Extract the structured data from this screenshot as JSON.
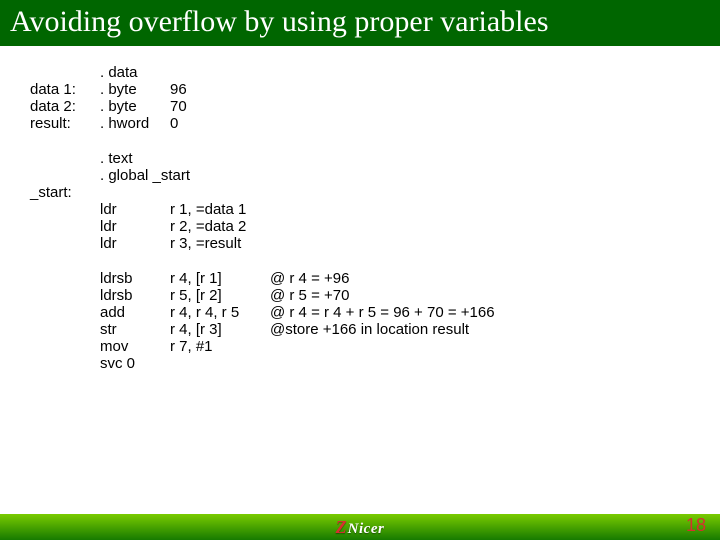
{
  "title": "Avoiding overflow by using proper variables",
  "footer": {
    "logo_z": "Z",
    "logo_nicer": "Nicer",
    "page": "18"
  },
  "code": {
    "data_section": {
      "directive": ". data",
      "lines": [
        {
          "label": "data 1:",
          "op": ". byte",
          "val": "96"
        },
        {
          "label": "data 2:",
          "op": ". byte",
          "val": "70"
        },
        {
          "label": "result:",
          "op": ". hword",
          "val": "0"
        }
      ]
    },
    "text_section": {
      "text_dir": ". text",
      "global_dir": ". global _start",
      "start_label": "_start:"
    },
    "ldr_block": [
      {
        "op": "ldr",
        "args": "r 1, =data 1"
      },
      {
        "op": "ldr",
        "args": "r 2, =data 2"
      },
      {
        "op": "ldr",
        "args": "r 3, =result"
      }
    ],
    "body_block": [
      {
        "op": "ldrsb",
        "args": "r 4, [r 1]",
        "cmt": "@ r 4 = +96"
      },
      {
        "op": "ldrsb",
        "args": "r 5, [r 2]",
        "cmt": "@ r 5 = +70"
      },
      {
        "op": "add",
        "args": "r 4, r 4, r 5",
        "cmt": "@ r 4 = r 4 + r 5 = 96 + 70 = +166"
      },
      {
        "op": "str",
        "args": "r 4, [r 3]",
        "cmt": "@store +166 in location result"
      },
      {
        "op": "mov",
        "args": "r 7, #1",
        "cmt": ""
      },
      {
        "op": "svc 0",
        "args": "",
        "cmt": ""
      }
    ]
  }
}
